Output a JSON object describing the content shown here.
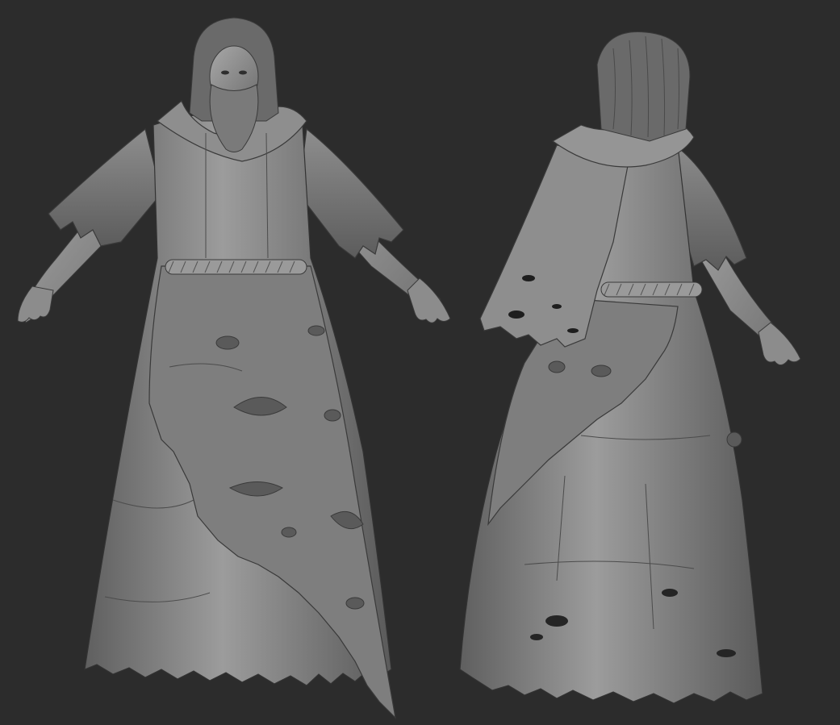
{
  "scene": {
    "background_color": "#2c2c2c",
    "views": [
      "front-view",
      "back-view"
    ],
    "colors": {
      "clay_light": "#a3a3a3",
      "clay_mid": "#808080",
      "clay_dark": "#5c5c5c",
      "clay_shadow": "#3a3a3a"
    }
  }
}
